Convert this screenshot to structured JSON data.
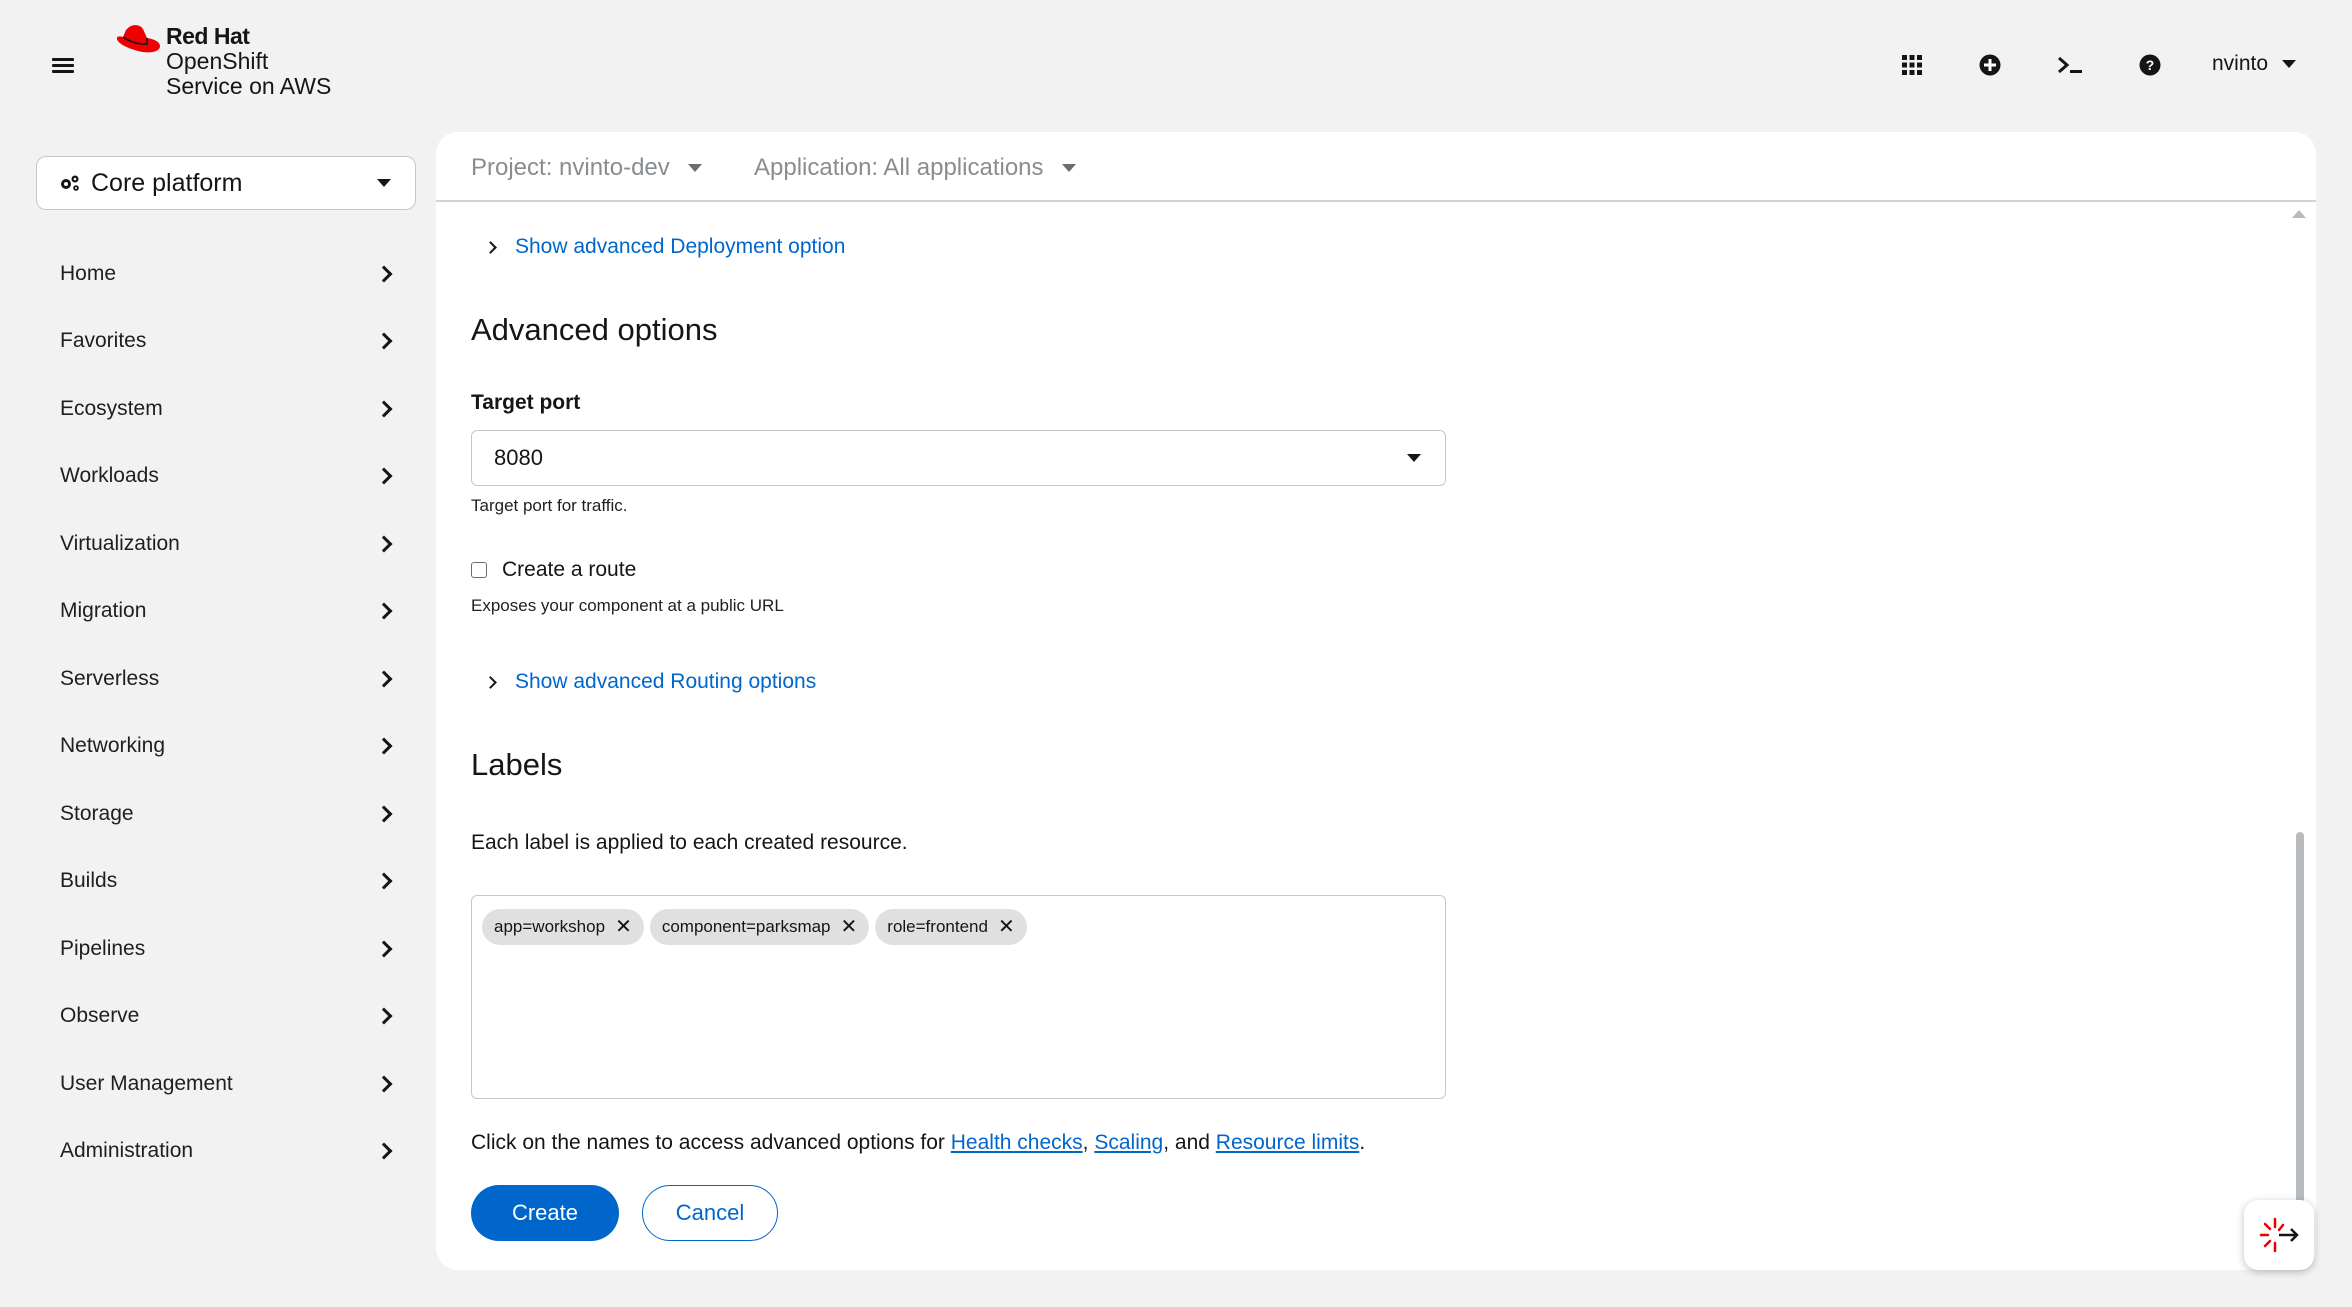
{
  "masthead": {
    "logo_brand": "Red Hat",
    "logo_product_line1": "OpenShift",
    "logo_product_line2": "Service on AWS",
    "username": "nvinto",
    "icons": [
      "hamburger-icon",
      "app-launcher-icon",
      "quick-create-icon",
      "terminal-icon",
      "help-icon"
    ]
  },
  "sidebar": {
    "perspective": "Core platform",
    "items": [
      {
        "label": "Home"
      },
      {
        "label": "Favorites"
      },
      {
        "label": "Ecosystem"
      },
      {
        "label": "Workloads"
      },
      {
        "label": "Virtualization"
      },
      {
        "label": "Migration"
      },
      {
        "label": "Serverless"
      },
      {
        "label": "Networking"
      },
      {
        "label": "Storage"
      },
      {
        "label": "Builds"
      },
      {
        "label": "Pipelines"
      },
      {
        "label": "Observe"
      },
      {
        "label": "User Management"
      },
      {
        "label": "Administration"
      }
    ]
  },
  "context": {
    "project": "Project: nvinto-dev",
    "application": "Application: All applications"
  },
  "form": {
    "deployment_expander": "Show advanced Deployment option",
    "advanced_title": "Advanced options",
    "target_port_label": "Target port",
    "target_port_value": "8080",
    "target_port_helper": "Target port for traffic.",
    "create_route_label": "Create a route",
    "create_route_checked": false,
    "create_route_helper": "Exposes your component at a public URL",
    "routing_expander": "Show advanced Routing options",
    "labels_title": "Labels",
    "labels_desc": "Each label is applied to each created resource.",
    "labels": [
      {
        "text": "app=workshop"
      },
      {
        "text": "component=parksmap"
      },
      {
        "text": "role=frontend"
      }
    ],
    "advanced_text_prefix": "Click on the names to access advanced options for ",
    "link_health": "Health checks",
    "sep1": ", ",
    "link_scaling": "Scaling",
    "sep2": ", and ",
    "link_limits": "Resource limits",
    "suffix": ".",
    "create_label": "Create",
    "cancel_label": "Cancel"
  },
  "colors": {
    "accent": "#0066cc",
    "redhat_red": "#ee0000",
    "background": "#f2f2f2"
  }
}
